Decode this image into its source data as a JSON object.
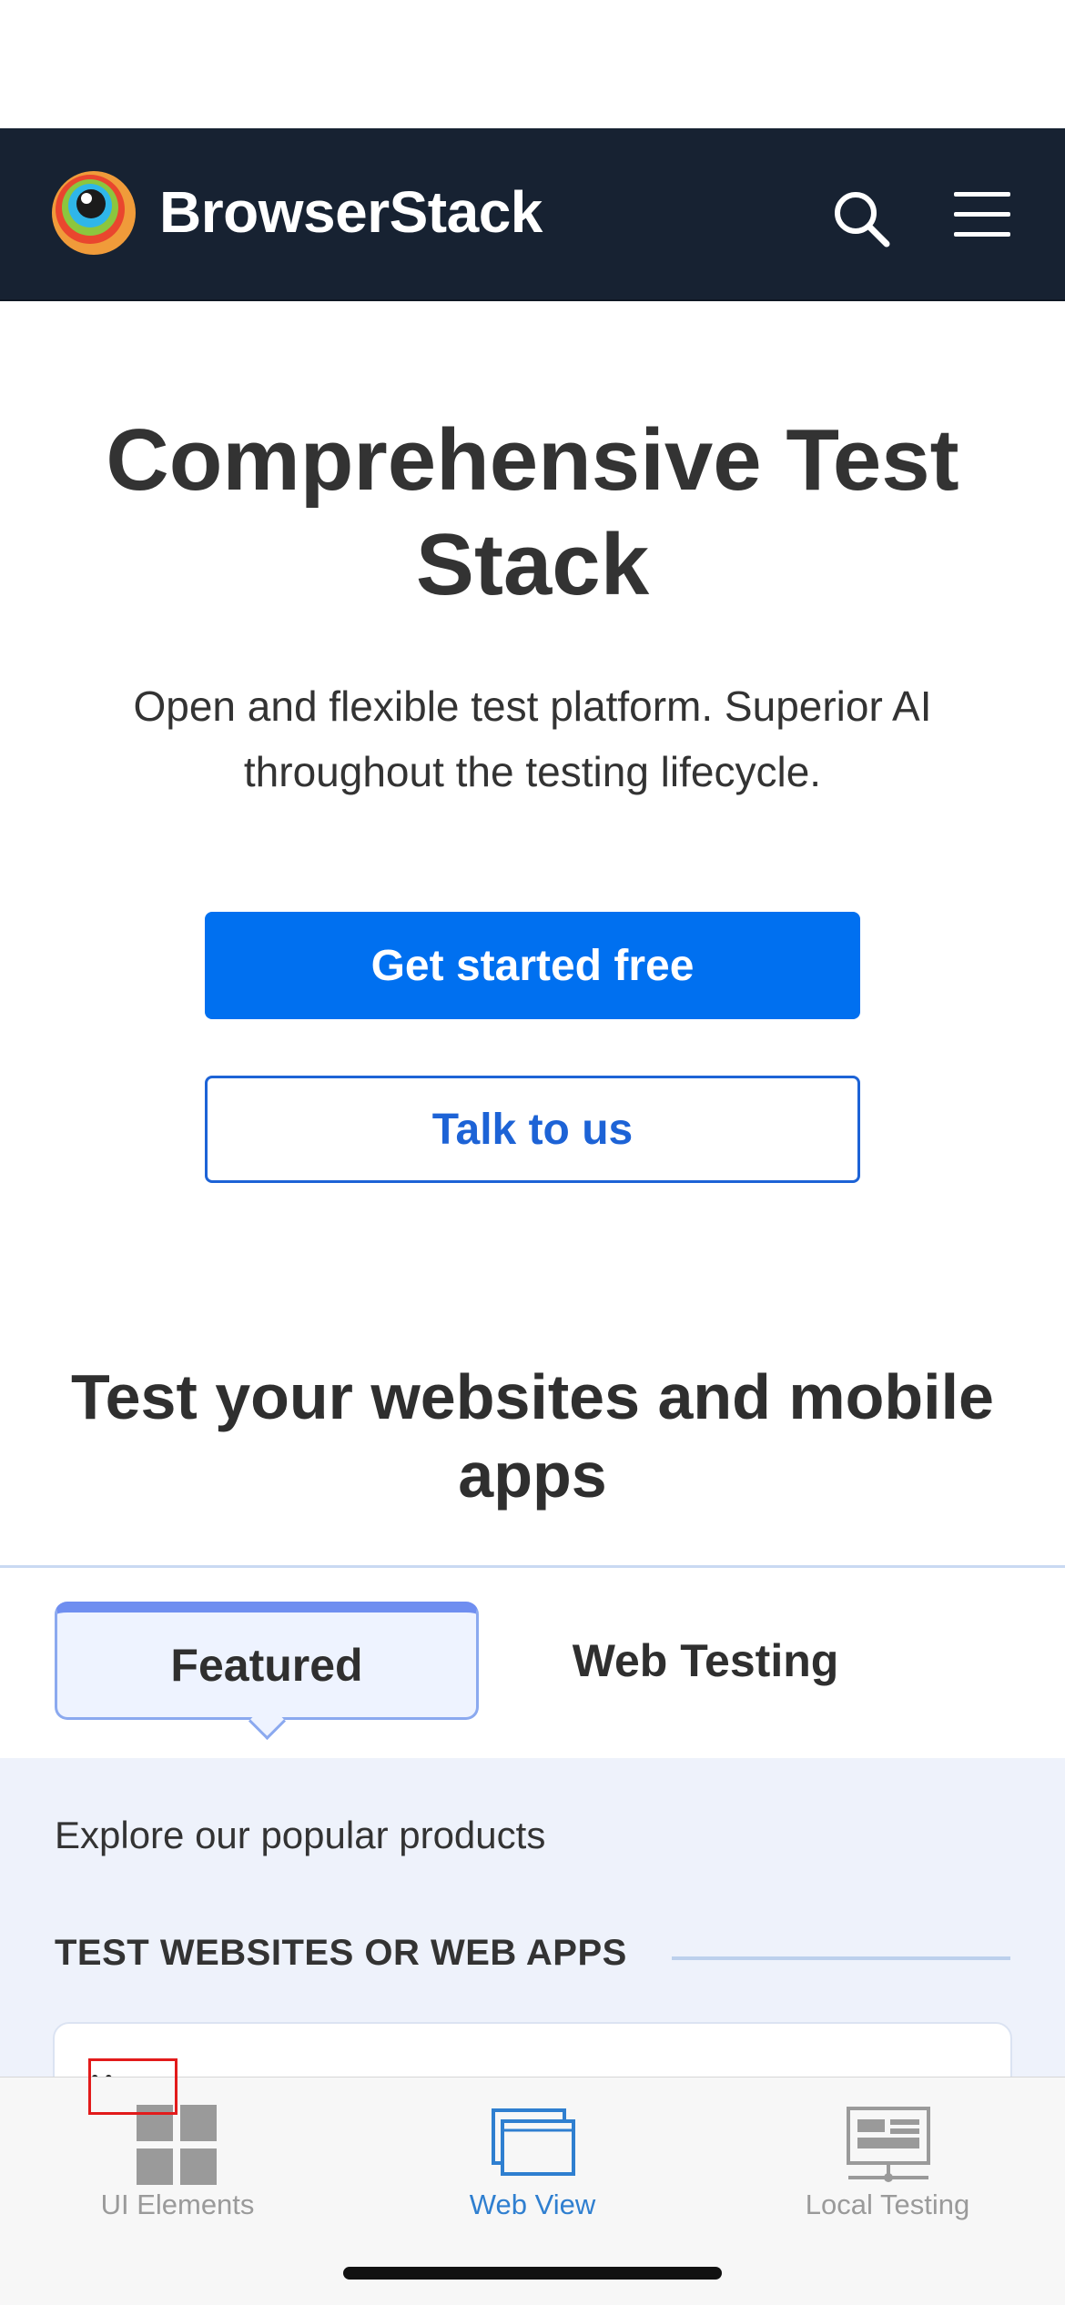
{
  "header": {
    "brand": "BrowserStack"
  },
  "hero": {
    "title": "Comprehensive Test Stack",
    "subtitle": "Open and flexible test platform. Superior AI throughout the testing lifecycle.",
    "primary_cta": "Get started free",
    "secondary_cta": "Talk to us"
  },
  "products": {
    "section_title": "Test your websites and mobile apps",
    "tabs": [
      {
        "label": "Featured",
        "active": true
      },
      {
        "label": "Web Testing",
        "active": false
      }
    ],
    "intro": "Explore our popular products",
    "category_heading": "TEST WEBSITES OR WEB APPS"
  },
  "tab_bar": {
    "items": [
      {
        "label": "UI Elements",
        "icon": "grid-icon",
        "active": false
      },
      {
        "label": "Web View",
        "icon": "windows-icon",
        "active": true
      },
      {
        "label": "Local Testing",
        "icon": "monitor-network-icon",
        "active": false
      }
    ]
  },
  "colors": {
    "navbar_bg": "#172232",
    "primary_blue": "#0070f0",
    "outline_blue": "#1d63d6",
    "tab_active": "#2f7fd0",
    "panel_bg": "#eef2fb"
  }
}
